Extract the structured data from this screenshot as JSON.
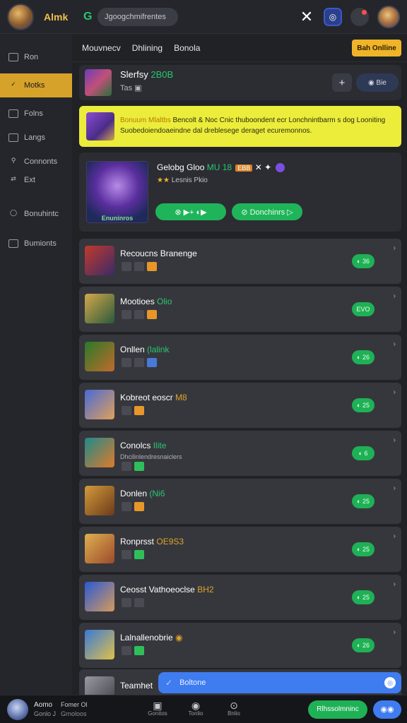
{
  "topbar": {
    "app_name": "Almk",
    "g_icon": "G",
    "search_text": "Jgoogchmifrentes",
    "close_icon": "✕",
    "insta_icon": "◎",
    "bell_icon": "●"
  },
  "sidebar": {
    "items": [
      {
        "label": "Ron",
        "icon": "square-icon"
      },
      {
        "label": "Motks",
        "icon": "check-icon",
        "active": true
      },
      {
        "label": "Folns",
        "icon": "square-icon"
      },
      {
        "label": "Langs",
        "icon": "square-icon"
      },
      {
        "label": "Connonts",
        "icon": "people-icon"
      },
      {
        "label": "Ext",
        "icon": "share-icon"
      },
      {
        "label": "Bonuhintc",
        "icon": "bulb-icon"
      },
      {
        "label": "Bumionts",
        "icon": "square-icon"
      }
    ]
  },
  "main": {
    "tabs": [
      "Mouvnecv",
      "Dhlining",
      "Bonola"
    ],
    "get_online": "Bah Onlline"
  },
  "profile": {
    "name": "Slerfsy",
    "name_highlight": "2B0B",
    "sub": "Tas ▣",
    "plus": "+",
    "follow": "◉ Bie"
  },
  "banner": {
    "title": "Bonuum Mlaltbs",
    "title_rest": "Bencolt & Noc Cnic thuboondent ecr Lonchnintbarm s dog Looniting",
    "desc": "Suobedoiendoaeindne dal dreblesege deraget ecuremonnos."
  },
  "feature": {
    "title": "Gelobg Gloo",
    "title_highlight": "MU 18",
    "badge": "EBB",
    "sub_star": "★★",
    "sub": "Lesnis Pkio",
    "thumb_label": "Enuninros",
    "pill_a": "⊗ ▶+ ◐▶",
    "pill_b": "⊘ Donchinrs ▷"
  },
  "rows": [
    {
      "title": "Recoucns Branenge",
      "highlight": "",
      "hl": "",
      "pill": "◐ 36",
      "icons": [
        "grey",
        "grey",
        "orange"
      ],
      "thumb": [
        "#c23a2a",
        "#3a2a6a"
      ]
    },
    {
      "title": "Mootioes",
      "highlight": "Olio",
      "hl": "green",
      "pill": "EVO",
      "icons": [
        "grey",
        "grey",
        "orange"
      ],
      "thumb": [
        "#d4a84a",
        "#2a5a3a"
      ]
    },
    {
      "title": "Onllen",
      "highlight": "(lalink",
      "hl": "green",
      "pill": "◐ 26",
      "icons": [
        "grey",
        "grey",
        "blue"
      ],
      "thumb": [
        "#2a7a2a",
        "#c26a2a"
      ]
    },
    {
      "title": "Kobreot eoscr",
      "highlight": "M8",
      "hl": "orange",
      "pill": "◐ 25",
      "icons": [
        "grey",
        "orange"
      ],
      "thumb": [
        "#4a6ad6",
        "#e0a05a"
      ]
    },
    {
      "title": "Conolcs",
      "highlight": "Ilite",
      "hl": "green",
      "sub": "Dhcilinlendresnaiclers",
      "pill": "◐ 6",
      "icons": [
        "grey",
        "green"
      ],
      "thumb": [
        "#1e8a8a",
        "#e07a2a"
      ]
    },
    {
      "title": "Donlen",
      "highlight": "(Ni6",
      "hl": "green",
      "pill": "◐ 25",
      "icons": [
        "grey",
        "orange"
      ],
      "thumb": [
        "#d49a3a",
        "#6a3a1a"
      ]
    },
    {
      "title": "Ronprsst",
      "highlight": "OE9S3",
      "hl": "orange",
      "pill": "◐ 25",
      "icons": [
        "grey",
        "green"
      ],
      "thumb": [
        "#e0b050",
        "#9a4a2a"
      ]
    },
    {
      "title": "Ceosst Vathoeoclse",
      "highlight": "BH2",
      "hl": "orange",
      "pill": "◐ 25",
      "icons": [
        "grey",
        "grey"
      ],
      "thumb": [
        "#2a5ad6",
        "#d69a5a"
      ]
    },
    {
      "title": "Lalnallenobrie",
      "highlight": "◉",
      "hl": "orange",
      "pill": "◐ 26",
      "icons": [
        "grey",
        "green"
      ],
      "thumb": [
        "#3a7ad6",
        "#e0c04a"
      ]
    }
  ],
  "toast": {
    "icon": "✓",
    "label": "Boltone",
    "close": "◎"
  },
  "partial_row": {
    "title": "Teamhet"
  },
  "bottombar": {
    "name": "Aomo",
    "name_sub": "Gonlo J",
    "user": "Fomer Ol",
    "user_sub": "Grnoloos",
    "tabs": [
      {
        "icon": "▣",
        "label": "Gonitos"
      },
      {
        "icon": "◉",
        "label": "Tonlio"
      },
      {
        "icon": "⊙",
        "label": "Bnlio"
      }
    ],
    "cta": "Rlhssolmninc",
    "fab": "◉◉"
  }
}
